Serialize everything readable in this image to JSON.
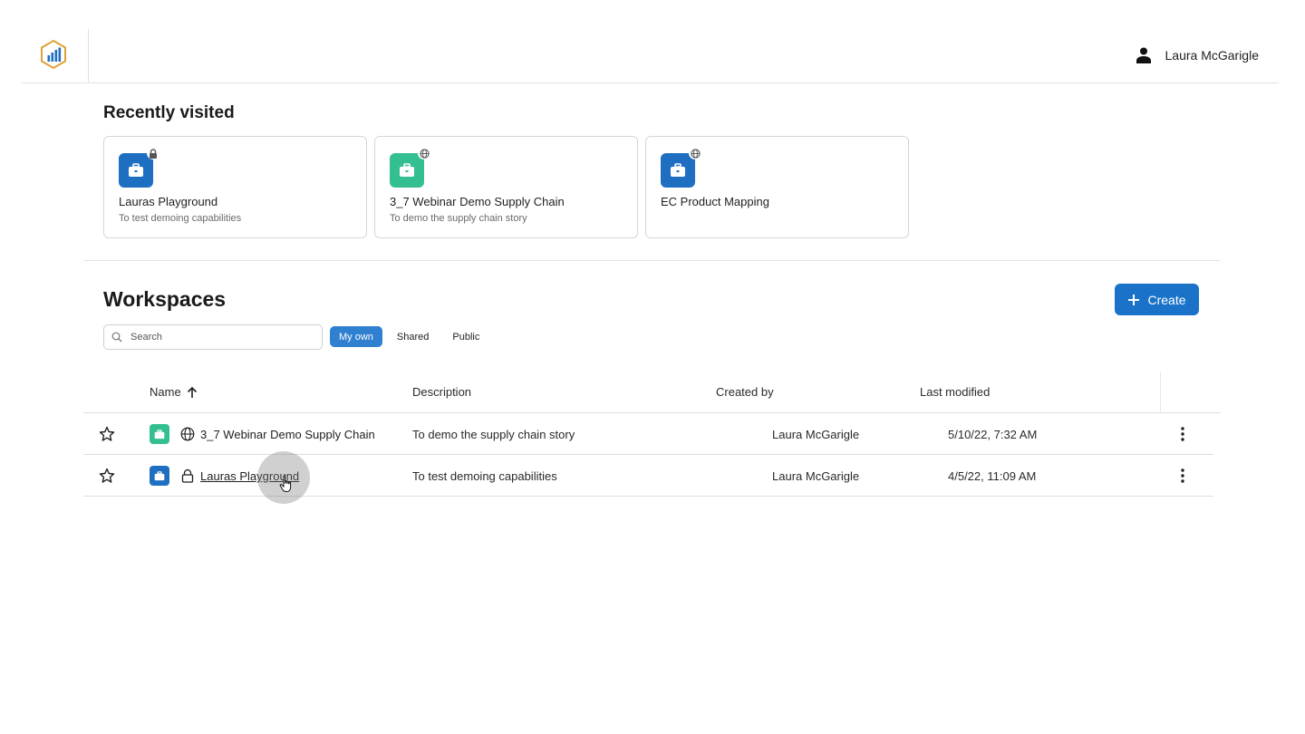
{
  "header": {
    "logo_icon": "bar-chart-hexagon-logo",
    "user_icon": "person-icon",
    "user_name": "Laura McGarigle"
  },
  "recent": {
    "title": "Recently visited",
    "cards": [
      {
        "name": "Lauras Playground",
        "description": "To test demoing capabilities",
        "icon_color": "#1e6fc2",
        "visibility_icon": "lock-icon"
      },
      {
        "name": "3_7 Webinar Demo Supply Chain",
        "description": "To demo the supply chain story",
        "icon_color": "#34bf93",
        "visibility_icon": "globe-icon"
      },
      {
        "name": "EC Product Mapping",
        "description": "",
        "icon_color": "#1e6fc2",
        "visibility_icon": "globe-icon"
      }
    ]
  },
  "workspaces": {
    "title": "Workspaces",
    "create_label": "Create",
    "search_placeholder": "Search",
    "filters": [
      "My own",
      "Shared",
      "Public"
    ],
    "active_filter": "My own",
    "columns": {
      "name": "Name",
      "description": "Description",
      "created_by": "Created by",
      "last_modified": "Last modified"
    },
    "rows": [
      {
        "name": "3_7 Webinar Demo Supply Chain",
        "description": "To demo the supply chain story",
        "created_by": "Laura McGarigle",
        "last_modified": "5/10/22, 7:32 AM",
        "icon_color": "#34bf93",
        "visibility_icon": "globe-icon"
      },
      {
        "name": "Lauras Playground",
        "description": "To test demoing capabilities",
        "created_by": "Laura McGarigle",
        "last_modified": "4/5/22, 11:09 AM",
        "icon_color": "#1e6fc2",
        "visibility_icon": "lock-icon"
      }
    ]
  },
  "colors": {
    "primary": "#1a73c8",
    "filter_active": "#2f80d0",
    "workspace_blue": "#1e6fc2",
    "workspace_green": "#34bf93"
  }
}
